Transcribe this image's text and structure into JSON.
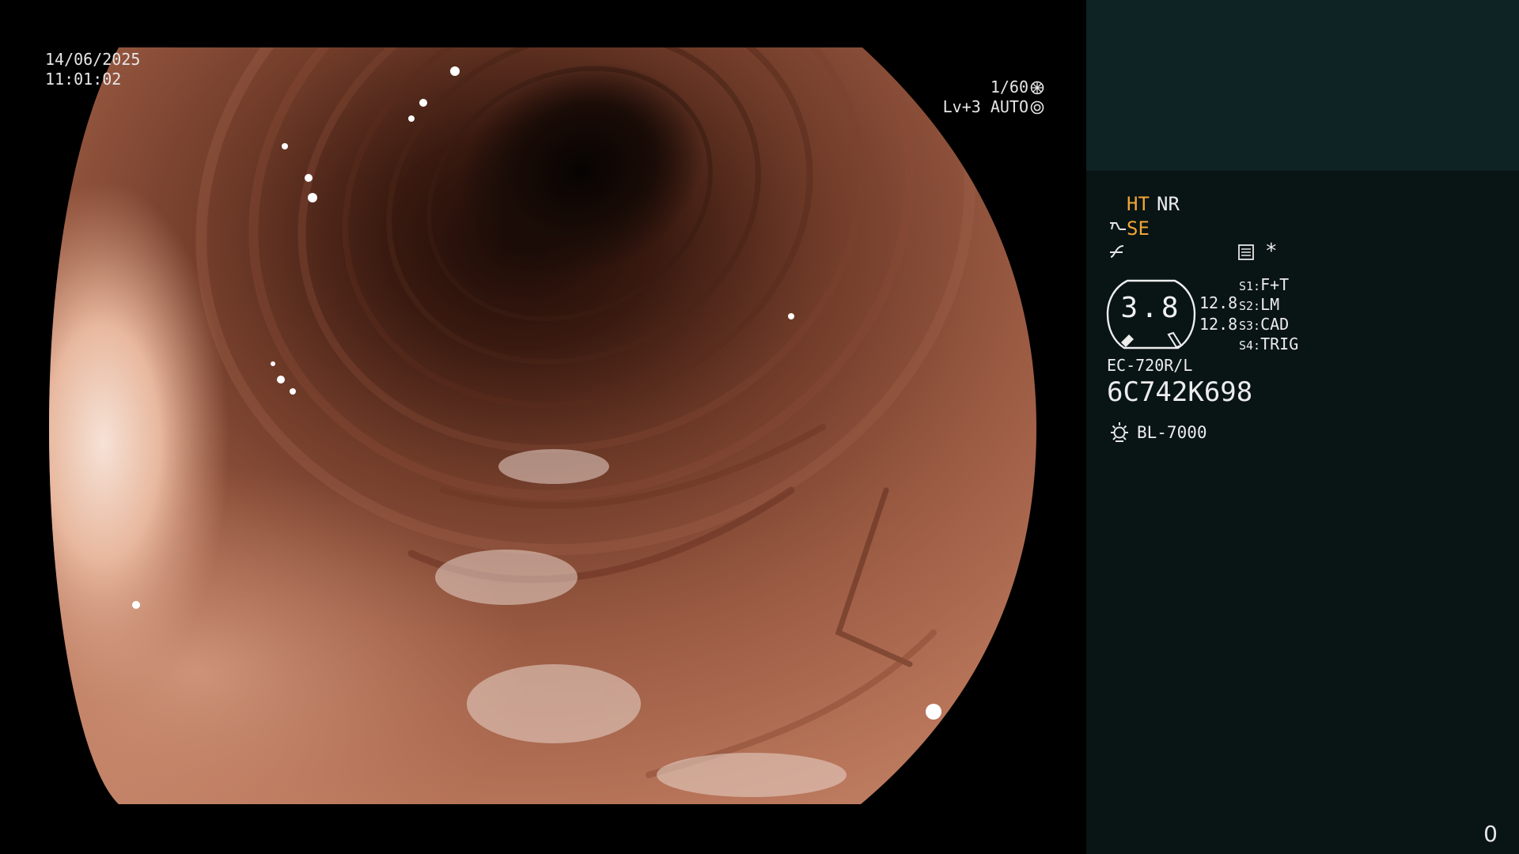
{
  "overlay": {
    "date": "14/06/2025",
    "time": "11:01:02",
    "shutter": "1/60",
    "level": "Lv+3 AUTO"
  },
  "panel": {
    "ht": "HT",
    "nr": "NR",
    "se": "SE",
    "star": "*",
    "gauge_value": "3.8",
    "gauge_upper": "12.8",
    "gauge_lower": "12.8",
    "switches": [
      {
        "key": "S1:",
        "value": "F+T"
      },
      {
        "key": "S2:",
        "value": "LM"
      },
      {
        "key": "S3:",
        "value": "CAD"
      },
      {
        "key": "S4:",
        "value": "TRIG"
      }
    ],
    "scope_model": "EC-720R/L",
    "serial": "6C742K698",
    "light_source": "BL-7000",
    "counter": "0"
  },
  "colors": {
    "accent_orange": "#f0a638",
    "panel_top": "#0d2324",
    "panel_bottom": "#091414"
  },
  "icons": [
    "shutter-icon",
    "auto-iris-icon",
    "se-scope-icon",
    "f-curve-icon",
    "list-icon",
    "lamp-icon"
  ]
}
